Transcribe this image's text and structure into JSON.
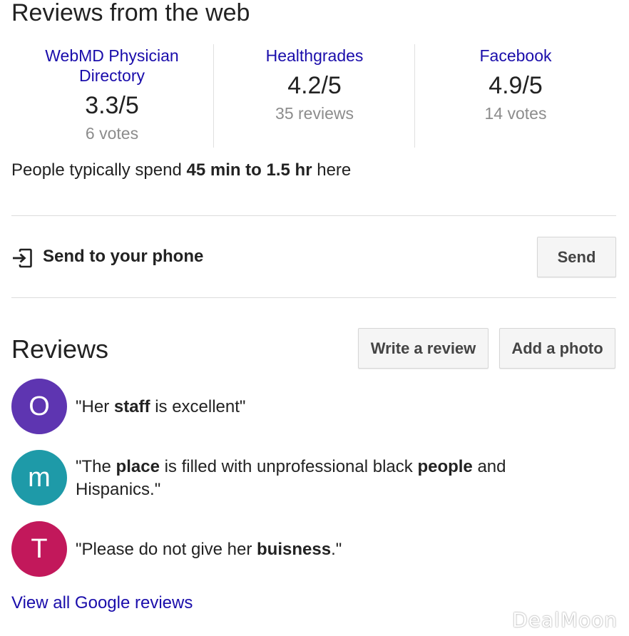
{
  "web_reviews": {
    "title": "Reviews from the web",
    "sources": [
      {
        "name": "WebMD Physician Directory",
        "rating": "3.3/5",
        "count": "6 votes"
      },
      {
        "name": "Healthgrades",
        "rating": "4.2/5",
        "count": "35 reviews"
      },
      {
        "name": "Facebook",
        "rating": "4.9/5",
        "count": "14 votes"
      }
    ],
    "typical_prefix": "People typically spend ",
    "typical_duration": "45 min to 1.5 hr",
    "typical_suffix": " here"
  },
  "send": {
    "icon": "send-to-phone-icon",
    "label": "Send to your phone",
    "button": "Send"
  },
  "reviews": {
    "title": "Reviews",
    "write_button": "Write a review",
    "photo_button": "Add a photo",
    "items": [
      {
        "initial": "O",
        "color": "#5e35b1",
        "parts": [
          "\"Her ",
          "staff",
          " is excellent\""
        ]
      },
      {
        "initial": "m",
        "color": "#1e9aa8",
        "parts": [
          "\"The ",
          "place",
          " is filled with unprofessional black ",
          "people",
          " and Hispanics.\""
        ]
      },
      {
        "initial": "T",
        "color": "#c2185b",
        "parts": [
          "\"Please do not give her ",
          "buisness",
          ".\""
        ]
      }
    ],
    "view_all": "View all Google reviews"
  },
  "watermark": "DealMoon",
  "colors": {
    "link": "#1a0dab",
    "muted": "#8c8c8c",
    "divider": "#dcdcdc"
  }
}
